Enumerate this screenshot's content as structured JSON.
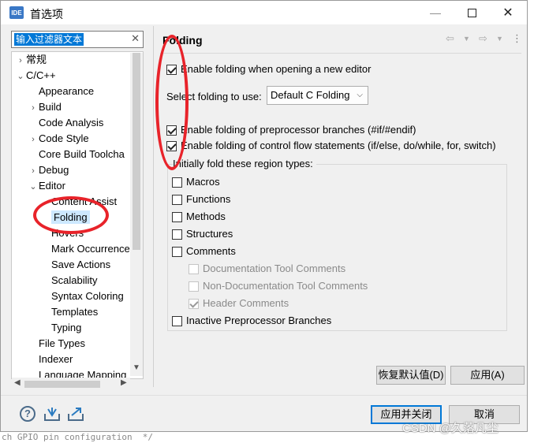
{
  "window": {
    "title": "首选项",
    "app_icon_text": "IDE"
  },
  "filter": {
    "value": "输入过滤器文本"
  },
  "tree": [
    {
      "label": "常规",
      "arrow": "›",
      "indent": 0
    },
    {
      "label": "C/C++",
      "arrow": "⌄",
      "indent": 0
    },
    {
      "label": "Appearance",
      "arrow": "",
      "indent": 1
    },
    {
      "label": "Build",
      "arrow": "›",
      "indent": 1
    },
    {
      "label": "Code Analysis",
      "arrow": "",
      "indent": 1
    },
    {
      "label": "Code Style",
      "arrow": "›",
      "indent": 1
    },
    {
      "label": "Core Build Toolcha",
      "arrow": "",
      "indent": 1
    },
    {
      "label": "Debug",
      "arrow": "›",
      "indent": 1
    },
    {
      "label": "Editor",
      "arrow": "⌄",
      "indent": 1
    },
    {
      "label": "Content Assist",
      "arrow": "",
      "indent": 2
    },
    {
      "label": "Folding",
      "arrow": "",
      "indent": 2,
      "selected": true
    },
    {
      "label": "Hovers",
      "arrow": "",
      "indent": 2
    },
    {
      "label": "Mark Occurrence",
      "arrow": "",
      "indent": 2
    },
    {
      "label": "Save Actions",
      "arrow": "",
      "indent": 2
    },
    {
      "label": "Scalability",
      "arrow": "",
      "indent": 2
    },
    {
      "label": "Syntax Coloring",
      "arrow": "",
      "indent": 2
    },
    {
      "label": "Templates",
      "arrow": "",
      "indent": 2
    },
    {
      "label": "Typing",
      "arrow": "",
      "indent": 2
    },
    {
      "label": "File Types",
      "arrow": "",
      "indent": 1
    },
    {
      "label": "Indexer",
      "arrow": "",
      "indent": 1
    },
    {
      "label": "Language Mapping",
      "arrow": "",
      "indent": 1
    }
  ],
  "page": {
    "title": "Folding",
    "enable_on_open": {
      "label": "Enable folding when opening a new editor",
      "checked": true
    },
    "select_label": "Select folding to use:",
    "folding_choice": "Default C Folding",
    "preprocessor": {
      "label": "Enable folding of preprocessor branches (#if/#endif)",
      "checked": true
    },
    "control_flow": {
      "label": "Enable folding of control flow statements (if/else, do/while, for, switch)",
      "checked": true
    },
    "region_group_label": "Initially fold these region types:",
    "regions": [
      {
        "label": "Macros",
        "checked": false,
        "enabled": true,
        "indent": 0
      },
      {
        "label": "Functions",
        "checked": false,
        "enabled": true,
        "indent": 0
      },
      {
        "label": "Methods",
        "checked": false,
        "enabled": true,
        "indent": 0
      },
      {
        "label": "Structures",
        "checked": false,
        "enabled": true,
        "indent": 0
      },
      {
        "label": "Comments",
        "checked": false,
        "enabled": true,
        "indent": 0
      },
      {
        "label": "Documentation Tool Comments",
        "checked": false,
        "enabled": false,
        "indent": 1
      },
      {
        "label": "Non-Documentation Tool Comments",
        "checked": false,
        "enabled": false,
        "indent": 1
      },
      {
        "label": "Header Comments",
        "checked": true,
        "enabled": false,
        "indent": 1
      },
      {
        "label": "Inactive Preprocessor Branches",
        "checked": false,
        "enabled": true,
        "indent": 0
      }
    ],
    "restore_defaults": "恢复默认值(D)",
    "apply": "应用(A)"
  },
  "footer": {
    "apply_close": "应用并关闭",
    "cancel": "取消",
    "help_glyph": "?"
  },
  "background_code": "ch GPIO pin configuration  */",
  "watermark": "CSDN @久落凡尘",
  "colors": {
    "accent": "#0078d7",
    "annotation": "#e8232a"
  }
}
